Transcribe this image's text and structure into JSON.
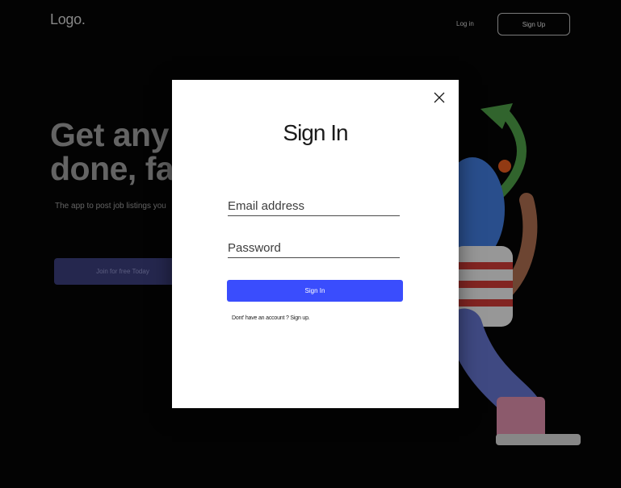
{
  "header": {
    "logo": "Logo.",
    "login_label": "Log in",
    "signup_label": "Sign Up"
  },
  "hero": {
    "title_line1": "Get any",
    "title_line2": "done, fa",
    "subtitle": "The app to post job listings you",
    "cta_label": "Join for free Today"
  },
  "modal": {
    "title": "Sign In",
    "email_placeholder": "Email address",
    "password_placeholder": "Password",
    "submit_label": "Sign In",
    "signup_prompt": "Dont' have an account ? Sign up."
  },
  "colors": {
    "accent": "#3a4dfd",
    "cta": "#3a3d78",
    "background": "#050505"
  },
  "icons": {
    "close": "close-icon"
  }
}
